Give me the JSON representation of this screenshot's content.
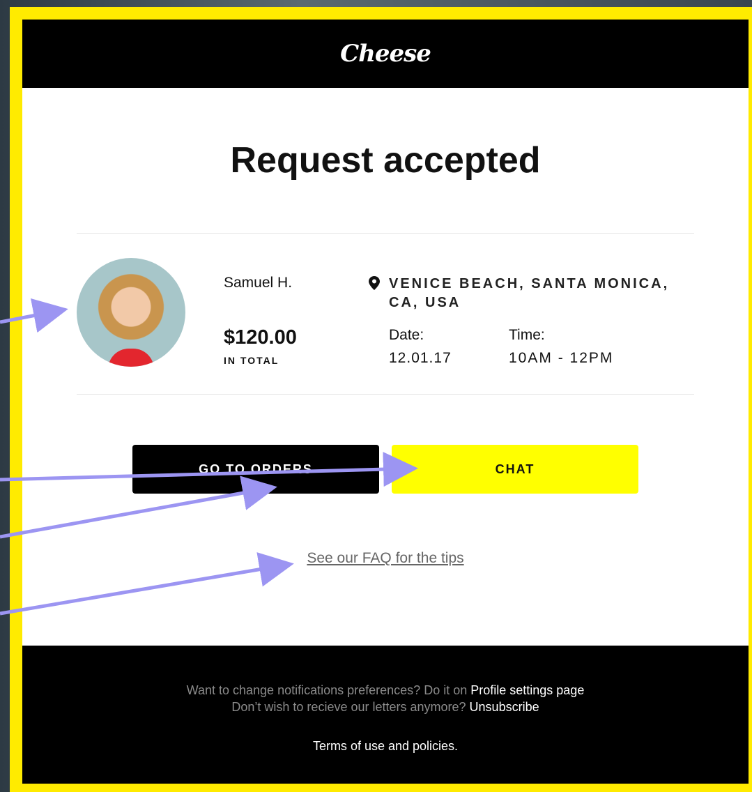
{
  "brand": {
    "logo": "Cheese"
  },
  "title": "Request accepted",
  "order": {
    "name": "Samuel H.",
    "price": "$120.00",
    "price_label": "IN TOTAL",
    "location": "VENICE BEACH, SANTA MONICA, CA, USA",
    "date_label": "Date:",
    "date": "12.01.17",
    "time_label": "Time:",
    "time": "10AM - 12PM"
  },
  "buttons": {
    "orders": "GO TO ORDERS",
    "chat": "CHAT"
  },
  "faq": "See our FAQ for the tips",
  "footer": {
    "line1_text": "Want to change notifications preferences? Do it on ",
    "line1_link": "Profile settings page",
    "line2_text": "Don’t wish to recieve our letters anymore? ",
    "line2_link": "Unsubscribe",
    "terms": "Terms of use and policies."
  },
  "colors": {
    "frame": "#ffeb00",
    "accent": "#ffff00",
    "arrow": "#9c95f2"
  }
}
